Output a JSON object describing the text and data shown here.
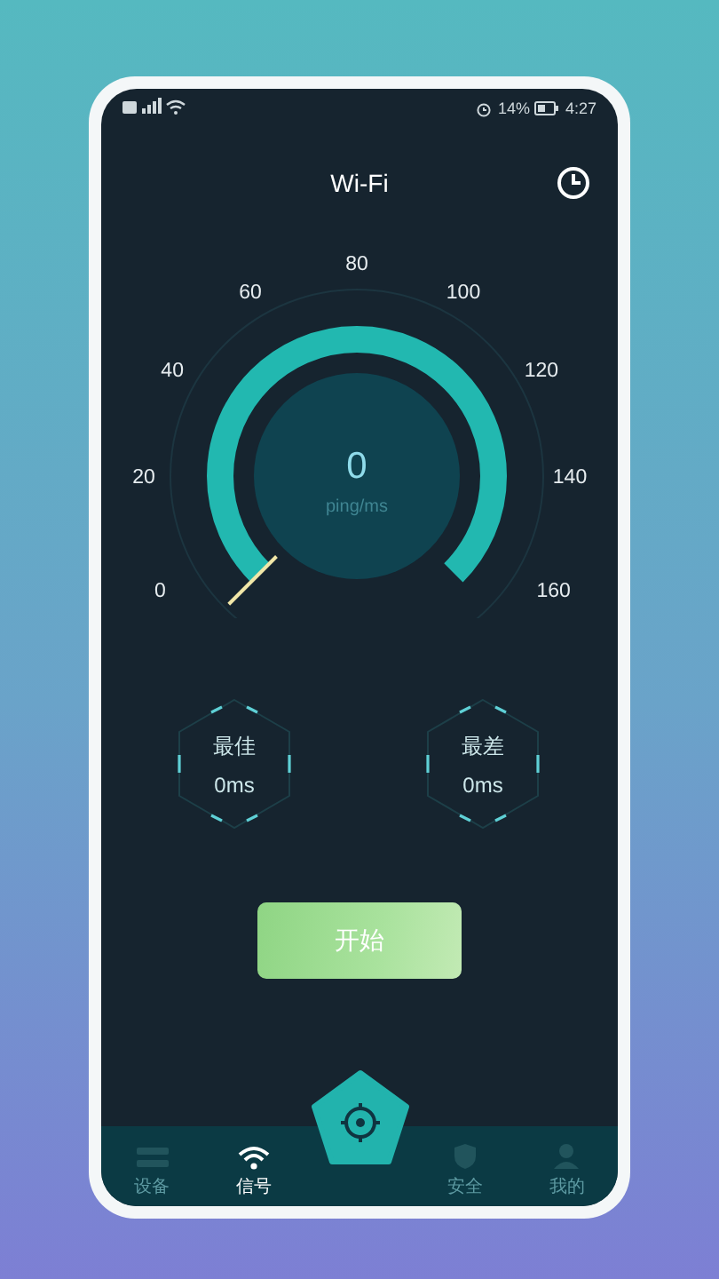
{
  "status_bar": {
    "battery": "14%",
    "time": "4:27"
  },
  "header": {
    "title": "Wi-Fi"
  },
  "gauge": {
    "scale_labels": [
      "0",
      "20",
      "40",
      "60",
      "80",
      "100",
      "120",
      "140",
      "160"
    ],
    "reading": "0",
    "unit": "ping/ms",
    "level": 0
  },
  "stats": [
    {
      "label": "最佳",
      "value": "0ms"
    },
    {
      "label": "最差",
      "value": "0ms"
    }
  ],
  "start_button": {
    "label": "开始"
  },
  "nav": {
    "tabs": [
      {
        "label": "设备",
        "selected": false
      },
      {
        "label": "信号",
        "selected": true
      },
      {
        "label": "安全",
        "selected": false
      },
      {
        "label": "我的",
        "selected": false
      }
    ]
  }
}
